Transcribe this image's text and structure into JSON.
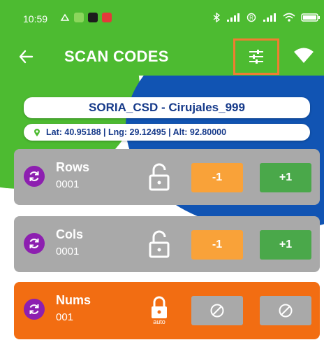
{
  "status_bar": {
    "time": "10:59",
    "left_icons": [
      "gallery-icon",
      "app-icon",
      "chat-icon",
      "mail-icon"
    ],
    "right_icons": [
      "bluetooth-icon",
      "signal-icon",
      "roaming-icon",
      "signal-icon",
      "wifi-icon",
      "battery-icon"
    ]
  },
  "app_bar": {
    "title": "SCAN CODES",
    "back_icon": "arrow-left-icon",
    "settings_icon": "sliders-icon",
    "wifi_icon": "wifi-icon",
    "settings_highlight_color": "#f07d31"
  },
  "site": {
    "name": "SORIA_CSD - Cirujales_999"
  },
  "location": {
    "lat_label": "Lat:",
    "lat": "40.95188",
    "lng_label": "Lng:",
    "lng": "29.12495",
    "alt_label": "Alt:",
    "alt": "92.80000",
    "text": "Lat: 40.95188 | Lng: 29.12495 | Alt: 92.80000"
  },
  "controls": [
    {
      "label": "Rows",
      "value": "0001",
      "locked": false,
      "lock_caption": "",
      "minus_label": "-1",
      "plus_label": "+1",
      "enabled": true
    },
    {
      "label": "Cols",
      "value": "0001",
      "locked": false,
      "lock_caption": "",
      "minus_label": "-1",
      "plus_label": "+1",
      "enabled": true
    },
    {
      "label": "Nums",
      "value": "001",
      "locked": true,
      "lock_caption": "auto",
      "minus_label": "",
      "plus_label": "",
      "enabled": false
    }
  ],
  "colors": {
    "primary_green": "#4dbb31",
    "accent_blue": "#1154b3",
    "card_gray": "#a9a9a9",
    "card_orange": "#f26d12",
    "minus_orange": "#f9a239",
    "plus_green": "#4aa84a",
    "sync_purple": "#8d1fb0",
    "text_navy": "#163a8a"
  }
}
